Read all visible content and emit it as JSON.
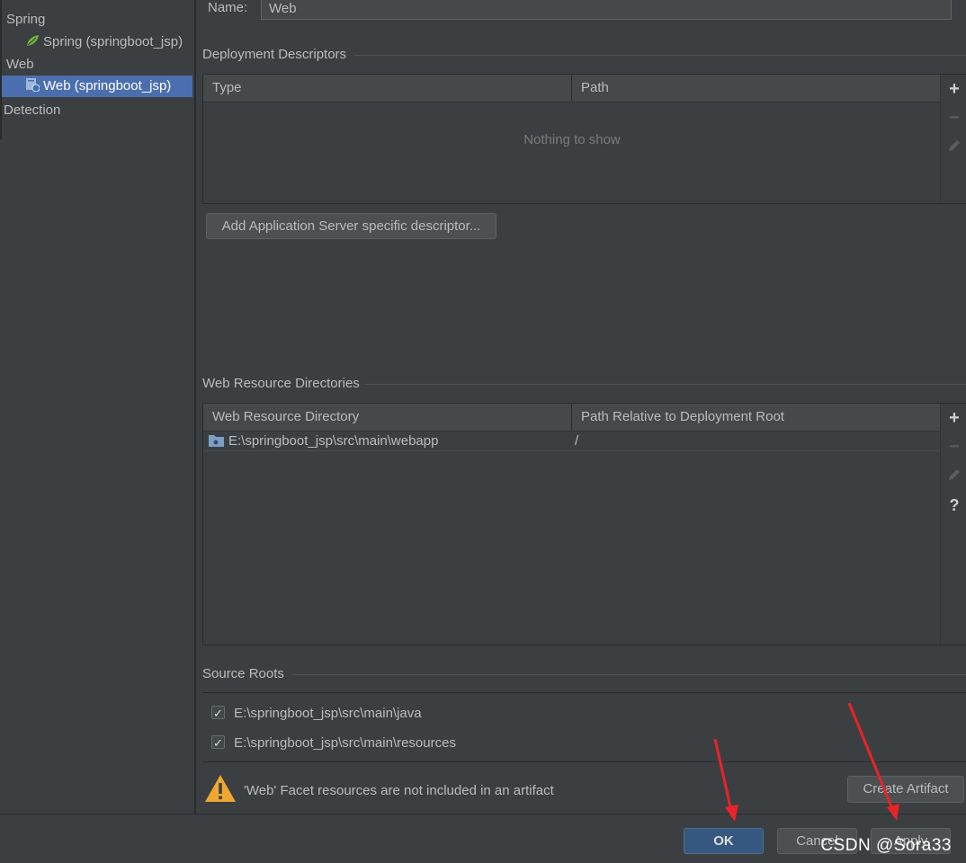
{
  "sidebar": {
    "groups": [
      {
        "label": "Spring",
        "items": [
          {
            "label": "Spring (springboot_jsp)",
            "icon": "spring-leaf-icon"
          }
        ]
      },
      {
        "label": "Web",
        "items": [
          {
            "label": "Web (springboot_jsp)",
            "icon": "web-facet-icon",
            "selected": true
          }
        ]
      }
    ],
    "detection_label": "Detection"
  },
  "facet": {
    "name_label": "Name:",
    "name_value": "Web"
  },
  "deployment_descriptors": {
    "title": "Deployment Descriptors",
    "columns": [
      "Type",
      "Path"
    ],
    "empty_text": "Nothing to show",
    "add_server_button": "Add Application Server specific descriptor..."
  },
  "web_resource_directories": {
    "title": "Web Resource Directories",
    "columns": [
      "Web Resource Directory",
      "Path Relative to Deployment Root"
    ],
    "rows": [
      {
        "directory": "E:\\springboot_jsp\\src\\main\\webapp",
        "relative_path": "/"
      }
    ]
  },
  "toolbar": {
    "add": "+",
    "remove": "−",
    "help": "?"
  },
  "source_roots": {
    "title": "Source Roots",
    "items": [
      {
        "path": "E:\\springboot_jsp\\src\\main\\java",
        "checked": true
      },
      {
        "path": "E:\\springboot_jsp\\src\\main\\resources",
        "checked": true
      }
    ]
  },
  "warning": {
    "text": "'Web' Facet resources are not included in an artifact",
    "create_artifact_button": "Create Artifact"
  },
  "dialog_buttons": {
    "ok": "OK",
    "cancel": "Cancel",
    "apply": "Apply"
  },
  "watermark": "CSDN @Sora33",
  "colors": {
    "background": "#3c3f41",
    "selection": "#4b6eaf",
    "primary_button": "#365880",
    "annotation_arrow": "#e8232a",
    "warning": "#f0a732"
  }
}
